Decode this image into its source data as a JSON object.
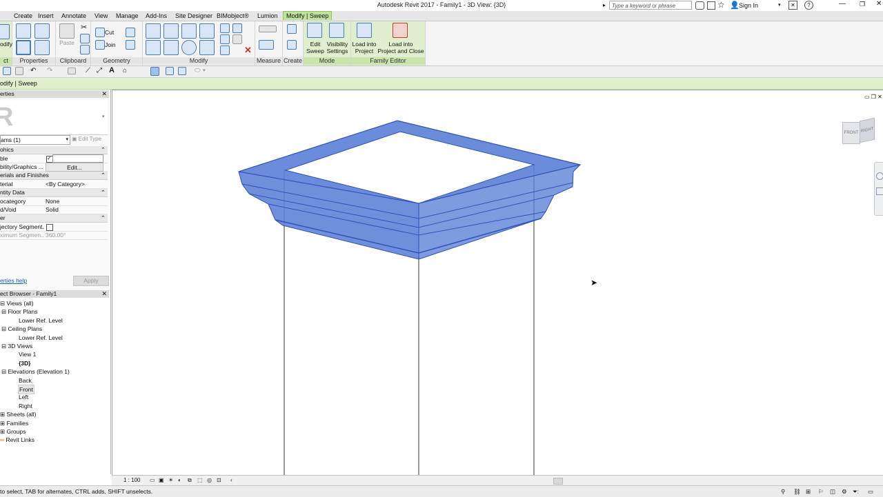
{
  "titlebar": {
    "title": "Autodesk Revit 2017 -    Family1 - 3D View: {3D}",
    "search_placeholder": "Type a keyword or phrase",
    "sign_in": "Sign In",
    "help": "?"
  },
  "tabs": [
    "Create",
    "Insert",
    "Annotate",
    "View",
    "Manage",
    "Add-Ins",
    "Site Designer",
    "BIMobject®",
    "Lumion",
    "Modify | Sweep"
  ],
  "ribbon": {
    "modify_label": "odify",
    "select_label": "ct",
    "panels": {
      "properties": "Properties",
      "clipboard": "Clipboard",
      "geometry": "Geometry",
      "modify": "Modify",
      "measure": "Measure",
      "create": "Create",
      "mode": "Mode",
      "family_editor": "Family Editor"
    },
    "paste": "Paste",
    "cut": "Cut",
    "join": "Join",
    "edit_sweep_1": "Edit",
    "edit_sweep_2": "Sweep",
    "visibility_1": "Visibility",
    "visibility_2": "Settings",
    "load_1": "Load into",
    "load_2": "Project",
    "load_close_1": "Load into",
    "load_close_2": "Project and Close"
  },
  "context_bar": "odify | Sweep",
  "properties": {
    "title": "erties",
    "type_selector": "ams (1)",
    "edit_type": "Edit Type",
    "groups": {
      "graphics": "ohics",
      "materials": "erials and Finishes",
      "identity": "ntity Data",
      "other": "er"
    },
    "rows": {
      "visible_k": "ble",
      "visgraphics_k": "bility/Graphics ...",
      "visgraphics_v": "Edit...",
      "material_k": "terial",
      "material_v": "<By Category>",
      "subcategory_k": "ocategory",
      "subcategory_v": "None",
      "solidvoid_k": "d/Void",
      "solidvoid_v": "Solid",
      "trajectory_k": "jectory Segment...",
      "maxseg_k": "ximum Segmen...",
      "maxseg_v": "360.00°"
    },
    "help": "erties help",
    "apply": "Apply"
  },
  "browser": {
    "title": "ect Browser - Family1",
    "items": [
      "Views (all)",
      "Floor Plans",
      "Lower Ref. Level",
      "Ceiling Plans",
      "Lower Ref. Level",
      "3D Views",
      "View 1",
      "{3D}",
      "Elevations (Elevation 1)",
      "Back",
      "Front",
      "Left",
      "Right",
      "Sheets (all)",
      "Families",
      "Groups",
      "Revit Links"
    ]
  },
  "viewcube": {
    "front": "FRONT",
    "right": "RIGHT"
  },
  "view_control": {
    "scale": "1 : 100"
  },
  "status": {
    "text": "to select, TAB for alternates, CTRL adds, SHIFT unselects."
  },
  "colors": {
    "selection_fill": "#5b7fd6",
    "selection_edge": "#2f52b8",
    "active_tab": "#bfe39a"
  }
}
